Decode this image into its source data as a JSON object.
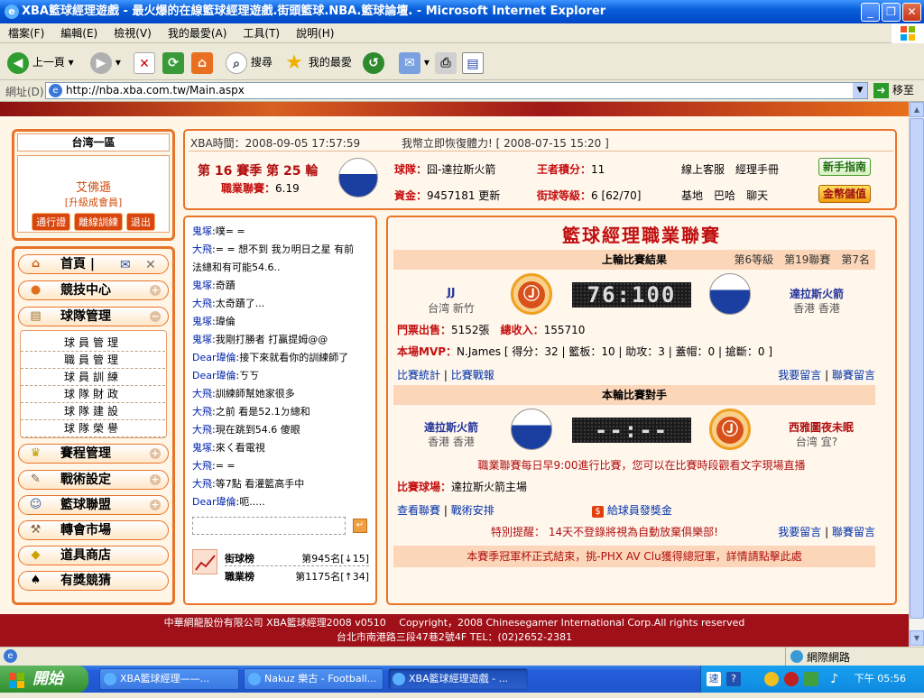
{
  "window": {
    "title": "XBA籃球經理遊戲 - 最火爆的在線籃球經理遊戲.街頭籃球.NBA.籃球論壇. - Microsoft Internet Explorer"
  },
  "menu": [
    "檔案(F)",
    "編輯(E)",
    "檢視(V)",
    "我的最愛(A)",
    "工具(T)",
    "說明(H)"
  ],
  "toolbar": {
    "back": "上一頁",
    "search": "搜尋",
    "favorites": "我的最愛"
  },
  "address": {
    "label": "網址(D)",
    "url": "http://nba.xba.com.tw/Main.aspx",
    "go": "移至"
  },
  "left": {
    "region": "台湾一區",
    "user_name": "艾佛遜",
    "user_rank": "[升級成會員]",
    "buttons": [
      "通行證",
      "離線訓練",
      "退出"
    ],
    "nav": [
      {
        "label": "首頁",
        "icon": "home-icon"
      },
      {
        "label": "競技中心",
        "icon": "basketball-icon"
      },
      {
        "label": "球隊管理",
        "icon": "clipboard-icon"
      },
      {
        "label": "賽程管理",
        "icon": "trophy-icon"
      },
      {
        "label": "戰術設定",
        "icon": "tactics-icon"
      },
      {
        "label": "籃球聯盟",
        "icon": "group-icon"
      },
      {
        "label": "轉會市場",
        "icon": "hammer-icon"
      },
      {
        "label": "道具商店",
        "icon": "gold-icon"
      },
      {
        "label": "有獎競猜",
        "icon": "spade-icon"
      }
    ],
    "submenu": [
      "球員管理",
      "職員管理",
      "球員訓練",
      "球隊財政",
      "球隊建設",
      "球隊榮譽"
    ]
  },
  "top_info": {
    "time_label": "XBA時間：",
    "time": "2008-09-05 17:57:59",
    "notice": "我幣立即恢復體力!",
    "notice_date": "[ 2008-07-15 15:20 ]",
    "season": "第 16 賽季 第 25 輪",
    "pro_label": "職業聯賽：",
    "pro_value": "6.19",
    "team_label": "球隊：",
    "team": "囧-達拉斯火箭",
    "points_label": "王者積分：",
    "points": "11",
    "service": "線上客服",
    "manual": "經理手冊",
    "funds_label": "資金：",
    "funds": "9457181",
    "update": "更新",
    "level_label": "街球等級：",
    "level": "6 [62/70]",
    "base": "基地",
    "bar": "巴哈",
    "chat": "聊天",
    "btn_guide": "新手指南",
    "btn_gold": "金幣儲值"
  },
  "chat": [
    {
      "user": "鬼塚",
      "text": ":噗= ="
    },
    {
      "user": "大飛",
      "text": ":= = 想不到 我ㄉ明日之星 有前"
    },
    {
      "user": "",
      "text": "法總和有可能54.6.."
    },
    {
      "user": "鬼塚",
      "text": ":奇蹟"
    },
    {
      "user": "大飛",
      "text": ":太奇蹟了..."
    },
    {
      "user": "鬼塚",
      "text": ":瑋倫"
    },
    {
      "user": "鬼塚",
      "text": ":我剛打勝者 打贏提姆@@"
    },
    {
      "user": "Dear瑋倫",
      "text": ":接下來就看你的訓練師了"
    },
    {
      "user": "Dear瑋倫",
      "text": ":ㄎㄎ"
    },
    {
      "user": "大飛",
      "text": ":訓練師幫她家很多"
    },
    {
      "user": "大飛",
      "text": ":之前 看是52.1ㄉ總和"
    },
    {
      "user": "大飛",
      "text": ":現在跳到54.6 傻眼"
    },
    {
      "user": "鬼塚",
      "text": ":來ㄑ看電視"
    },
    {
      "user": "大飛",
      "text": ":= ="
    },
    {
      "user": "大飛",
      "text": ":等7點 看灌籃高手中"
    },
    {
      "user": "Dear瑋倫",
      "text": ":呃....."
    }
  ],
  "rank": {
    "street_label": "街球榜",
    "street_value": "第945名[↓15]",
    "pro_label": "職業榜",
    "pro_value": "第1175名[↑34]"
  },
  "main": {
    "title": "籃球經理職業聯賽",
    "last_head": "上輪比賽結果",
    "last_meta": "第6等級　第19聯賽　第7名",
    "home_team": "JJ",
    "home_loc": "台湾 新竹",
    "score": "76:100",
    "away_team": "達拉斯火箭",
    "away_loc": "香港 香港",
    "tickets_label": "門票出售：",
    "tickets": "5152張",
    "income_label": "總收入：",
    "income": "155710",
    "mvp_label": "本場MVP：",
    "mvp": "N.James",
    "mvp_stats": "[ 得分：32 | 籃板：10 | 助攻：3 | 蓋帽：0 | 搶斷：0 ]",
    "link_stats": "比賽統計",
    "link_report": "比賽戰報",
    "link_msg": "我要留言",
    "link_league_msg": "聯賽留言",
    "next_head": "本輪比賽對手",
    "next_home": "達拉斯火箭",
    "next_home_loc": "香港 香港",
    "next_score": "--:--",
    "next_away": "西雅圖夜未眠",
    "next_away_loc": "台湾 宜?",
    "daily_note": "職業聯賽每日早9:00進行比賽，您可以在比賽時段觀看文字現場直播",
    "venue_label": "比賽球場：",
    "venue": "達拉斯火箭主場",
    "link_league": "查看聯賽",
    "link_tactics": "戰術安排",
    "bonus": "給球員發獎金",
    "reminder": "特別提醒： 14天不登錄將視為自動放棄俱樂部!",
    "bottom_note": "本賽季冠軍杯正式結束，挑-PHX AV Clu獲得總冠軍，詳情請點擊此處"
  },
  "footer": {
    "line1": "中華網龍股份有限公司 XBA籃球經理2008 v0510　 Copyright，2008 Chinesegamer International Corp.All rights reserved",
    "line2": "台北市南港路三段47巷2號4F TEL：(02)2652-2381"
  },
  "status": {
    "zone": "網際網路"
  },
  "taskbar": {
    "start": "開始",
    "tasks": [
      "XBA籃球經理——...",
      "Nakuz 樂古 - Football...",
      "XBA籃球經理遊戲 - ..."
    ],
    "clock": "下午 05:56"
  }
}
